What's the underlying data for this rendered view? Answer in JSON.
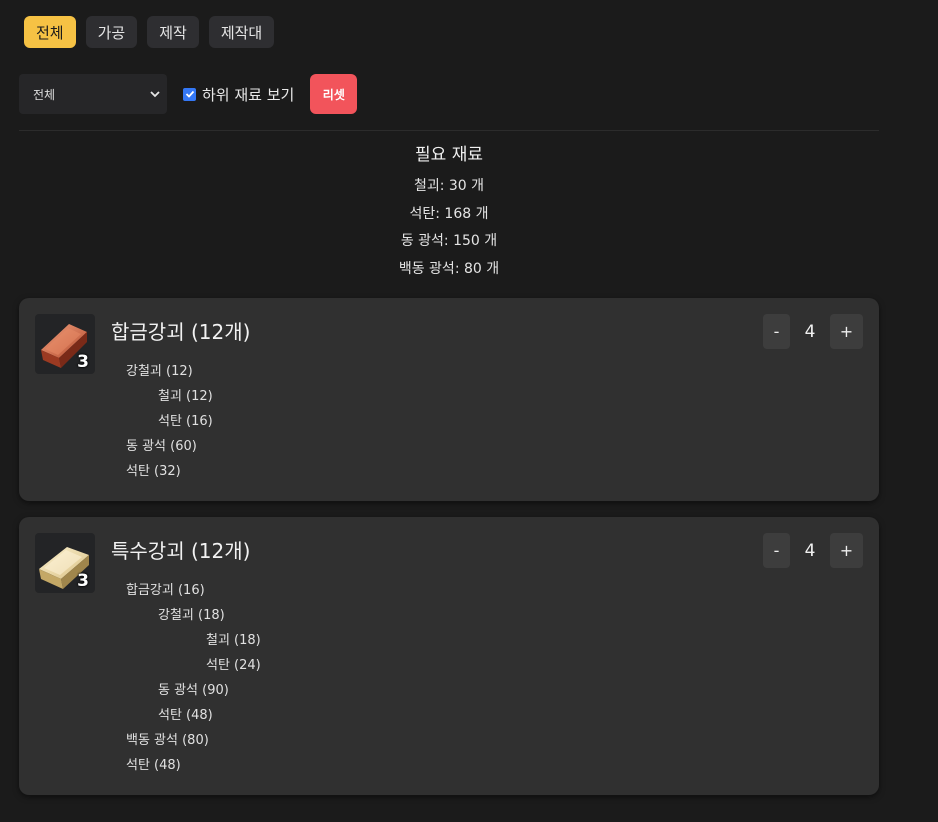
{
  "tabs": [
    "전체",
    "가공",
    "제작",
    "제작대"
  ],
  "filter": {
    "select_value": "전체",
    "checkbox_label": "하위 재료 보기",
    "checked": true,
    "reset_label": "리셋"
  },
  "summary": {
    "title": "필요 재료",
    "lines": [
      "철괴: 30 개",
      "석탄: 168 개",
      "동 광석: 150 개",
      "백동 광석: 80 개"
    ]
  },
  "cards": [
    {
      "title": "합금강괴 (12개)",
      "icon": "copper-ingot-icon",
      "icon_count": "3",
      "qty": "4",
      "minus": "-",
      "plus": "+",
      "tree": [
        "강철괴 (12)",
        "철괴 (12)",
        "석탄 (16)",
        "동 광석 (60)",
        "석탄 (32)"
      ]
    },
    {
      "title": "특수강괴 (12개)",
      "icon": "gold-ingot-icon",
      "icon_count": "3",
      "qty": "4",
      "minus": "-",
      "plus": "+",
      "tree": [
        "합금강괴 (16)",
        "강철괴 (18)",
        "철괴 (18)",
        "석탄 (24)",
        "동 광석 (90)",
        "석탄 (48)",
        "백동 광석 (80)",
        "석탄 (48)"
      ]
    }
  ],
  "colors": {
    "accent": "#f6c244",
    "reset": "#f2545b",
    "card": "#303030",
    "background": "#1b1b1b"
  }
}
